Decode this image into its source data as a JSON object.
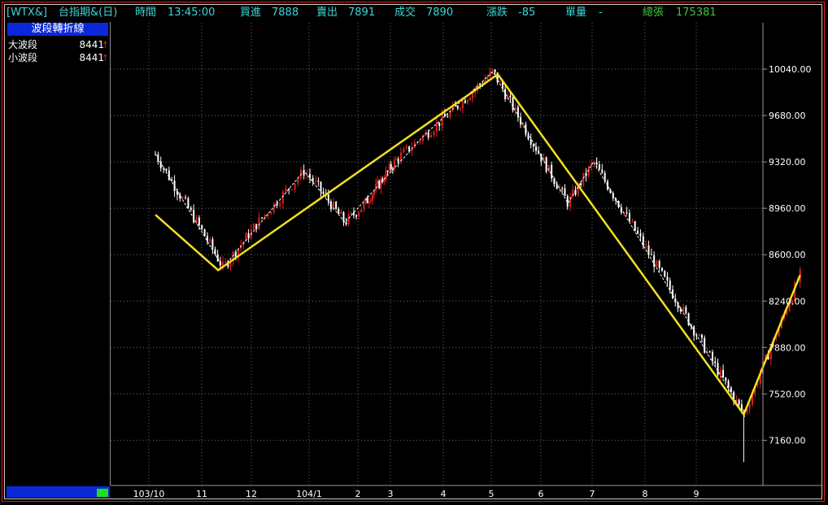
{
  "header": {
    "symbol": "[WTX&]",
    "name": "台指期&(日)",
    "time_label": "時間",
    "time_value": "13:45:00",
    "bid_label": "買進",
    "bid_value": "7888",
    "ask_label": "賣出",
    "ask_value": "7891",
    "deal_label": "成交",
    "deal_value": "7890",
    "change_label": "漲跌",
    "change_value": "-85",
    "vol_label": "單量",
    "vol_value": "-",
    "total_label": "總張",
    "total_value": "175381"
  },
  "indicator_panel": {
    "title": "波段轉折線",
    "rows": [
      {
        "label": "大波段",
        "value": "8441",
        "arrow": "↑"
      },
      {
        "label": "小波段",
        "value": "8441",
        "arrow": "↑"
      }
    ]
  },
  "colors": {
    "up_candle": "#e02020",
    "down_candle": "#ffffff",
    "major_wave": "#f0e020",
    "minor_wave": "#ffffff",
    "grid": "#6a6a6a",
    "axis_text": "#ffffff"
  },
  "chart_data": {
    "type": "candlestick",
    "x_tick_labels": [
      "103/10",
      "11",
      "12",
      "104/1",
      "2",
      "3",
      "4",
      "5",
      "6",
      "7",
      "8",
      "9"
    ],
    "y_tick_labels": [
      "10040.00",
      "9680.00",
      "9320.00",
      "8960.00",
      "8600.00",
      "8240.00",
      "7880.00",
      "7520.00",
      "7160.00"
    ],
    "y_ticks": [
      10040,
      9680,
      9320,
      8960,
      8600,
      8240,
      7880,
      7520,
      7160
    ],
    "ylim": [
      6860,
      10160
    ],
    "last_close": 8441,
    "major_wave_line": [
      {
        "month": 0.0,
        "value": 8910
      },
      {
        "month": 1.2,
        "value": 8480
      },
      {
        "month": 7.0,
        "value": 10000
      },
      {
        "month": 11.8,
        "value": 7360
      },
      {
        "month": 12.9,
        "value": 8441
      }
    ],
    "minor_wave_line": [
      {
        "month": 0.0,
        "value": 9380
      },
      {
        "month": 1.3,
        "value": 8500
      },
      {
        "month": 2.8,
        "value": 9250
      },
      {
        "month": 3.6,
        "value": 8850
      },
      {
        "month": 5.5,
        "value": 9520
      },
      {
        "month": 6.9,
        "value": 10020
      },
      {
        "month": 8.4,
        "value": 9000
      },
      {
        "month": 8.9,
        "value": 9320
      },
      {
        "month": 11.8,
        "value": 7360
      },
      {
        "month": 12.9,
        "value": 8441
      }
    ]
  }
}
